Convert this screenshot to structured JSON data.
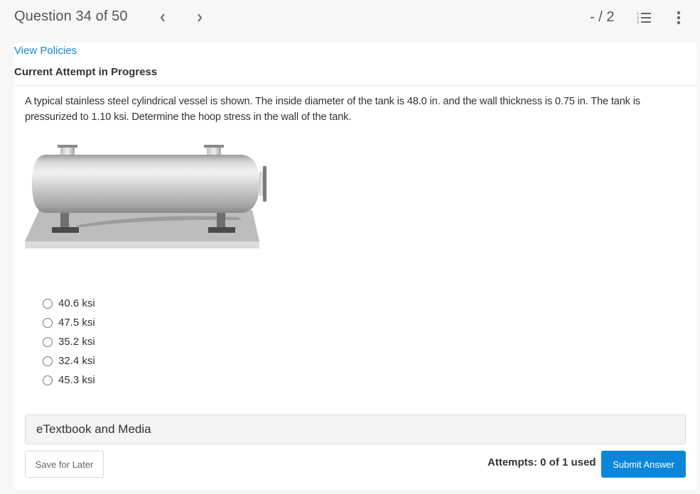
{
  "header": {
    "question_title": "Question 34 of 50",
    "prev_icon": "chevron-left-icon",
    "next_icon": "chevron-right-icon",
    "score": "- / 2",
    "question_list_icon": "numbered-list-icon",
    "more_icon": "vertical-ellipsis-icon"
  },
  "card": {
    "view_policies_link": "View Policies",
    "attempt_heading": "Current Attempt in Progress",
    "question_text": "A typical stainless steel cylindrical vessel is shown. The inside diameter of the tank is 48.0 in. and the wall thickness is 0.75 in. The tank is pressurized to 1.10 ksi. Determine the hoop stress in the wall of the tank.",
    "figure_description": "Horizontal cylindrical pressure vessel on two saddle supports mounted on a base plate",
    "choices": [
      {
        "label": "40.6 ksi",
        "selected": false
      },
      {
        "label": "47.5 ksi",
        "selected": false
      },
      {
        "label": "35.2 ksi",
        "selected": false
      },
      {
        "label": "32.4 ksi",
        "selected": false
      },
      {
        "label": "45.3 ksi",
        "selected": false
      }
    ],
    "etextbook_label": "eTextbook and Media",
    "save_button": "Save for Later",
    "attempts_text": "Attempts: 0 of 1 used",
    "submit_button": "Submit Answer"
  },
  "colors": {
    "link": "#1a85d6",
    "primary_button": "#0c86d9",
    "page_background": "#f7f7f7"
  }
}
